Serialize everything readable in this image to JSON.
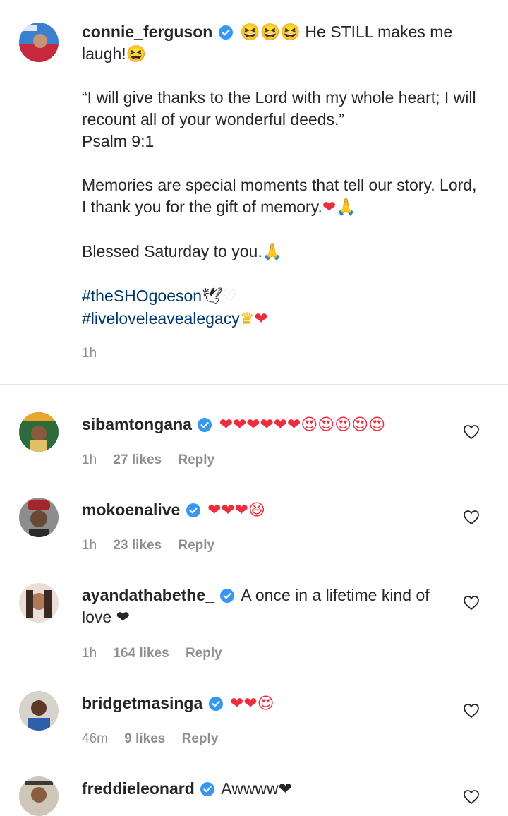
{
  "post": {
    "username": "connie_ferguson",
    "first_line": "😆😆😆 He STILL makes me laugh!😆",
    "quote_1": "“I will give thanks to the Lord with my whole heart; I will recount all of your wonderful deeds.”",
    "quote_2": "Psalm 9:1",
    "memories": "Memories are special moments that tell our story. Lord, I thank you for the gift of memory.",
    "blessed": "Blessed Saturday to you.",
    "hashtag_1": "#theSHOgoeson",
    "hashtag_2": "#liveloveleavealegacy",
    "time": "1h"
  },
  "comments": [
    {
      "username": "sibamtongana",
      "text": "❤❤❤❤❤❤😍😍😍😍😍",
      "time": "1h",
      "likes": "27 likes",
      "reply": "Reply"
    },
    {
      "username": "mokoenalive",
      "text": "❤❤❤😆",
      "time": "1h",
      "likes": "23 likes",
      "reply": "Reply"
    },
    {
      "username": "ayandathabethe_",
      "text": "A once in a lifetime kind of love ❤",
      "time": "1h",
      "likes": "164 likes",
      "reply": "Reply"
    },
    {
      "username": "bridgetmasinga",
      "text": "❤❤😍",
      "time": "46m",
      "likes": "9 likes",
      "reply": "Reply"
    },
    {
      "username": "freddieleonard",
      "text": "Awwww❤",
      "time": "",
      "likes": "",
      "reply": ""
    }
  ],
  "colors": {
    "link": "#00376b",
    "verified": "#3897f0",
    "muted": "#8e8e8e",
    "heart": "#ed2d3d"
  }
}
